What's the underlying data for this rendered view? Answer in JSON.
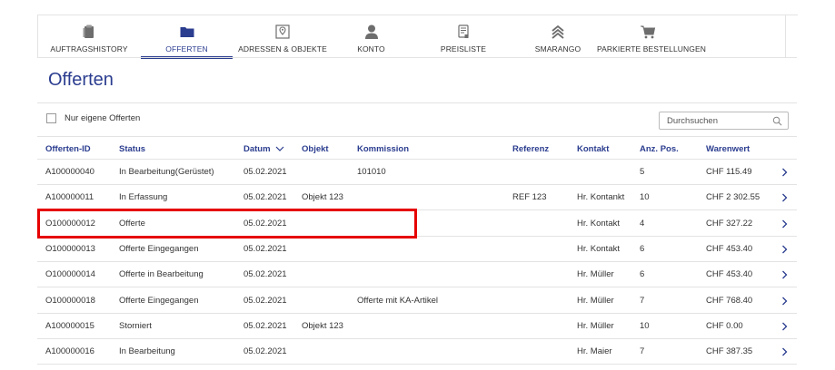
{
  "nav": {
    "items": [
      {
        "label": "Auftragshistory",
        "icon": "clipboard-icon"
      },
      {
        "label": "Offerten",
        "icon": "folder-icon"
      },
      {
        "label": "Adressen & Objekte",
        "icon": "map-pin-icon"
      },
      {
        "label": "Konto",
        "icon": "user-icon"
      },
      {
        "label": "Preisliste",
        "icon": "price-list-icon"
      },
      {
        "label": "Smarango",
        "icon": "smarango-icon"
      },
      {
        "label": "Parkierte Bestellungen",
        "icon": "cart-icon"
      }
    ],
    "active_index": 1
  },
  "page_title": "Offerten",
  "filter": {
    "label": "Nur eigene Offerten"
  },
  "search": {
    "placeholder": "Durchsuchen"
  },
  "table": {
    "headers": {
      "id": "Offerten-ID",
      "status": "Status",
      "datum": "Datum",
      "objekt": "Objekt",
      "kommission": "Kommission",
      "referenz": "Referenz",
      "kontakt": "Kontakt",
      "anzpos": "Anz. Pos.",
      "warenwert": "Warenwert"
    },
    "rows": [
      {
        "id": "A100000040",
        "status": "In Bearbeitung(Gerüstet)",
        "datum": "05.02.2021",
        "objekt": "",
        "kommission": "101010",
        "referenz": "",
        "kontakt": "",
        "anzpos": "5",
        "warenwert": "CHF 115.49"
      },
      {
        "id": "A100000011",
        "status": "In Erfassung",
        "datum": "05.02.2021",
        "objekt": "Objekt 123",
        "kommission": "",
        "referenz": "REF 123",
        "kontakt": "Hr. Kontankt",
        "anzpos": "10",
        "warenwert": "CHF 2 302.55"
      },
      {
        "id": "O100000012",
        "status": "Offerte",
        "datum": "05.02.2021",
        "objekt": "",
        "kommission": "",
        "referenz": "",
        "kontakt": "Hr. Kontakt",
        "anzpos": "4",
        "warenwert": "CHF 327.22"
      },
      {
        "id": "O100000013",
        "status": "Offerte Eingegangen",
        "datum": "05.02.2021",
        "objekt": "",
        "kommission": "",
        "referenz": "",
        "kontakt": "Hr. Kontakt",
        "anzpos": "6",
        "warenwert": "CHF 453.40"
      },
      {
        "id": "O100000014",
        "status": "Offerte in Bearbeitung",
        "datum": "05.02.2021",
        "objekt": "",
        "kommission": "",
        "referenz": "",
        "kontakt": "Hr. Müller",
        "anzpos": "6",
        "warenwert": "CHF 453.40"
      },
      {
        "id": "O100000018",
        "status": "Offerte Eingegangen",
        "datum": "05.02.2021",
        "objekt": "",
        "kommission": "Offerte mit KA-Artikel",
        "referenz": "",
        "kontakt": "Hr. Müller",
        "anzpos": "7",
        "warenwert": "CHF 768.40"
      },
      {
        "id": "A100000015",
        "status": "Storniert",
        "datum": "05.02.2021",
        "objekt": "Objekt 123",
        "kommission": "",
        "referenz": "",
        "kontakt": "Hr. Müller",
        "anzpos": "10",
        "warenwert": "CHF 0.00"
      },
      {
        "id": "A100000016",
        "status": "In Bearbeitung",
        "datum": "05.02.2021",
        "objekt": "",
        "kommission": "",
        "referenz": "",
        "kontakt": "Hr. Maier",
        "anzpos": "7",
        "warenwert": "CHF 387.35"
      }
    ],
    "highlighted_row": 2
  },
  "colors": {
    "accent": "#2b3d8f",
    "highlight": "#e60000",
    "icon_grey": "#6d6d6d"
  }
}
